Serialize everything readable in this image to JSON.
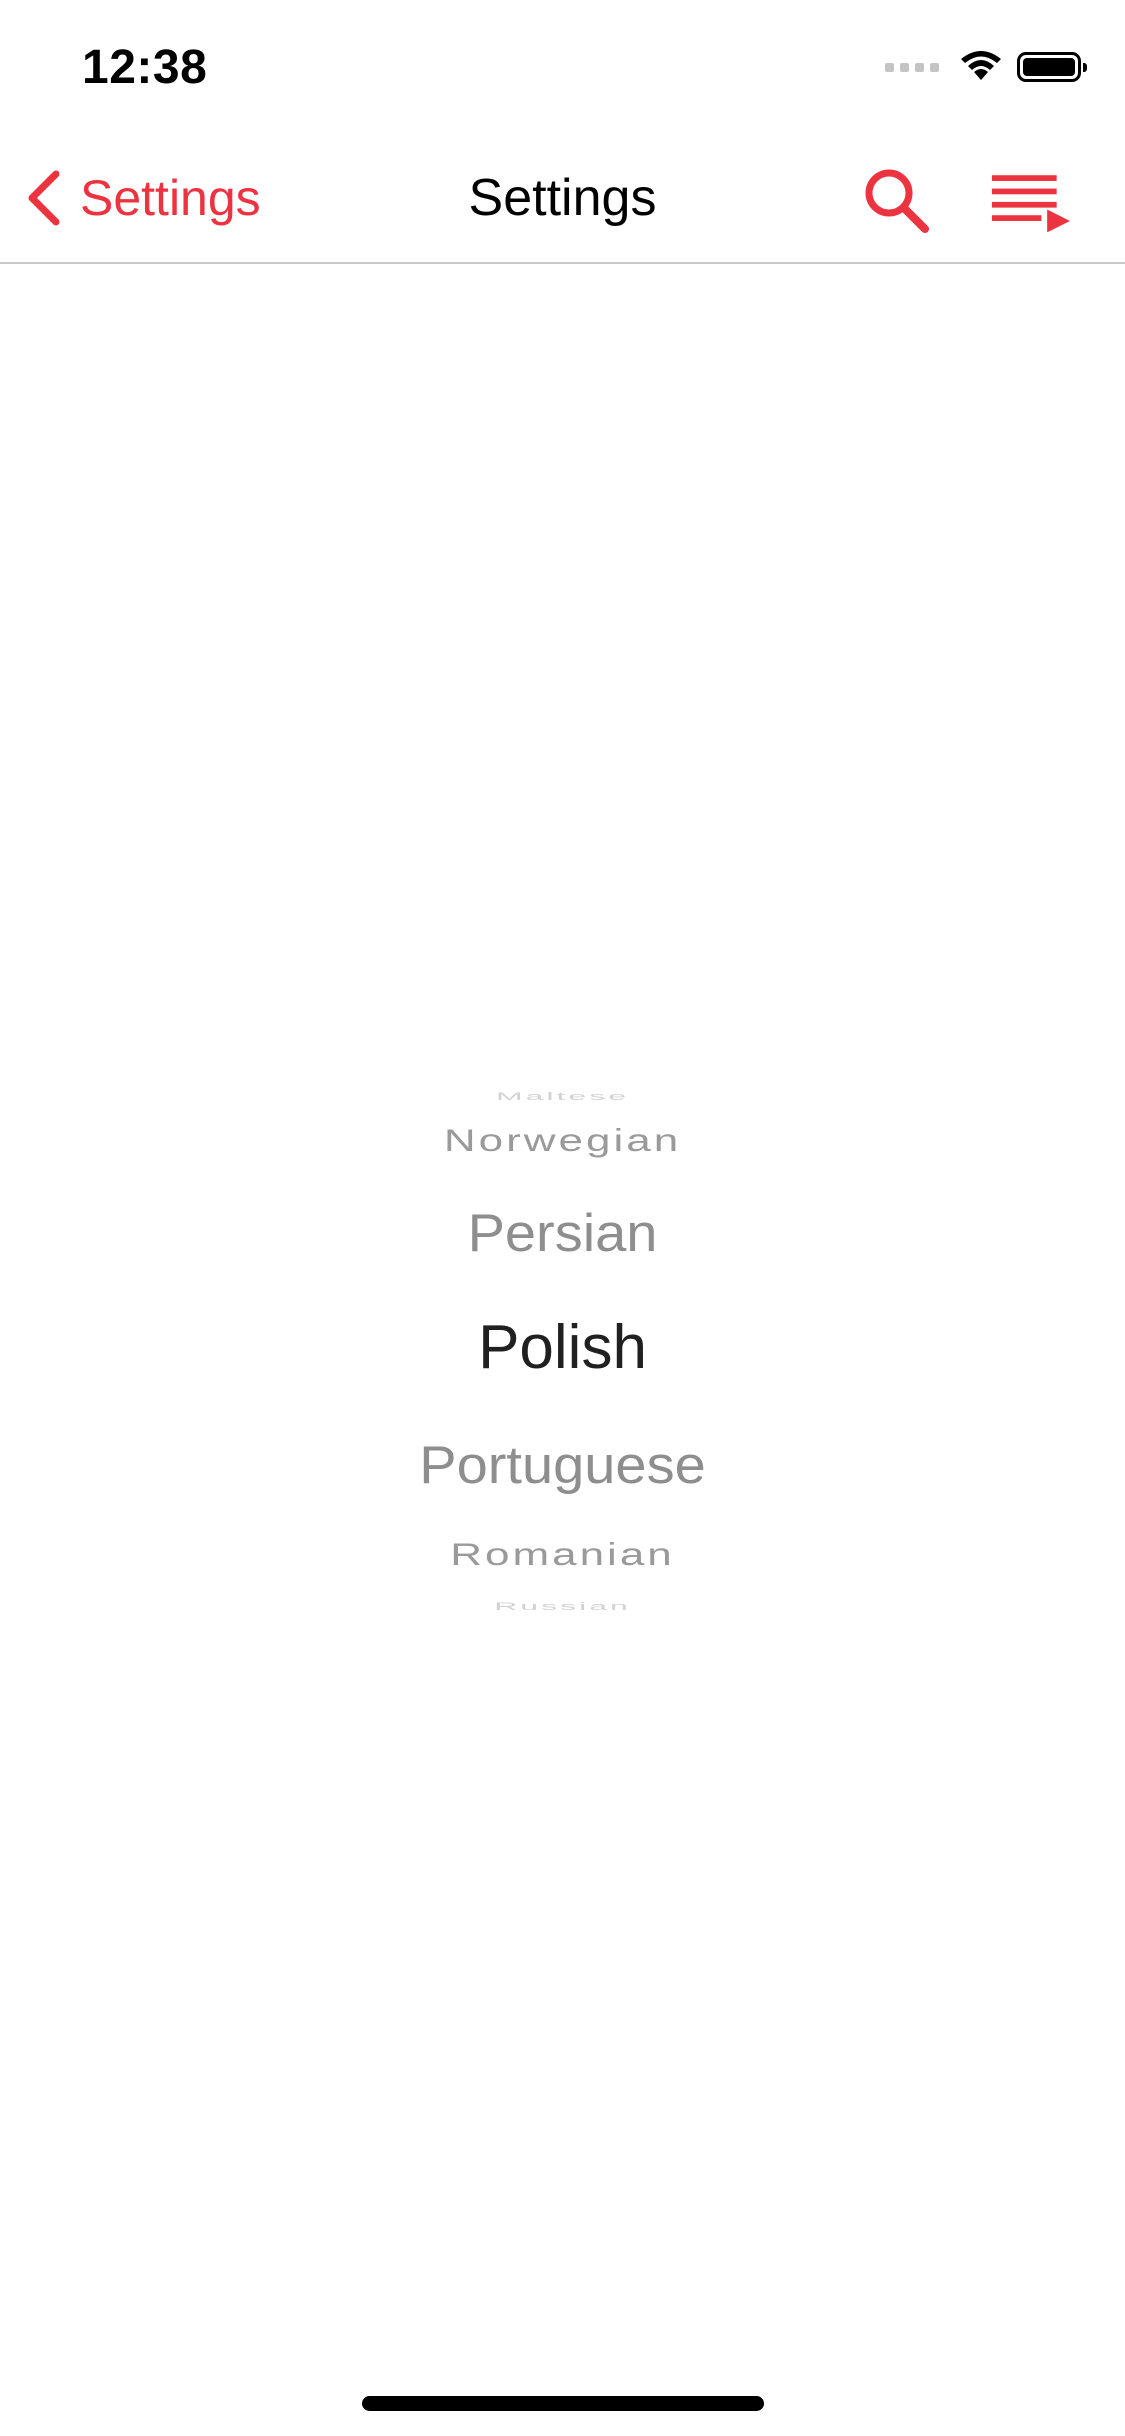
{
  "status_bar": {
    "time": "12:38"
  },
  "nav": {
    "back_label": "Settings",
    "title": "Settings",
    "accent_color": "#ec3340",
    "actions": [
      {
        "icon": "search-icon"
      },
      {
        "icon": "play-queue-icon"
      }
    ]
  },
  "picker": {
    "items": [
      "Maltese",
      "Norwegian",
      "Persian",
      "Polish",
      "Portuguese",
      "Romanian",
      "Russian"
    ],
    "selected": "Polish"
  }
}
